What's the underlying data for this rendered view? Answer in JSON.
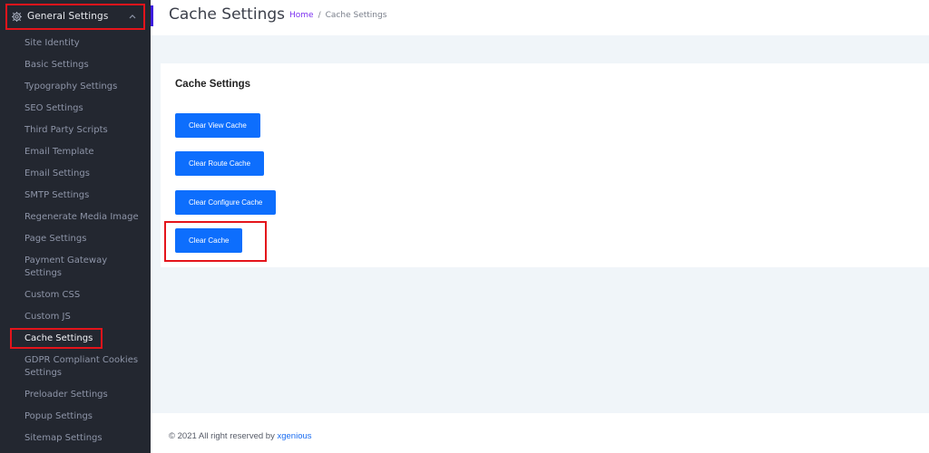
{
  "sidebar": {
    "group": {
      "label": "General Settings",
      "icon": "gear-icon",
      "expanded": true
    },
    "items": [
      {
        "label": "Site Identity",
        "active": false
      },
      {
        "label": "Basic Settings",
        "active": false
      },
      {
        "label": "Typography Settings",
        "active": false
      },
      {
        "label": "SEO Settings",
        "active": false
      },
      {
        "label": "Third Party Scripts",
        "active": false
      },
      {
        "label": "Email Template",
        "active": false
      },
      {
        "label": "Email Settings",
        "active": false
      },
      {
        "label": "SMTP Settings",
        "active": false
      },
      {
        "label": "Regenerate Media Image",
        "active": false
      },
      {
        "label": "Page Settings",
        "active": false
      },
      {
        "label": "Payment Gateway Settings",
        "active": false
      },
      {
        "label": "Custom CSS",
        "active": false
      },
      {
        "label": "Custom JS",
        "active": false
      },
      {
        "label": "Cache Settings",
        "active": true
      },
      {
        "label": "GDPR Compliant Cookies Settings",
        "active": false
      },
      {
        "label": "Preloader Settings",
        "active": false
      },
      {
        "label": "Popup Settings",
        "active": false
      },
      {
        "label": "Sitemap Settings",
        "active": false
      }
    ]
  },
  "header": {
    "title": "Cache Settings",
    "breadcrumb": {
      "home": "Home",
      "separator": "/",
      "current": "Cache Settings"
    }
  },
  "card": {
    "title": "Cache Settings",
    "buttons": [
      {
        "label": "Clear View Cache"
      },
      {
        "label": "Clear Route Cache"
      },
      {
        "label": "Clear Configure Cache"
      },
      {
        "label": "Clear Cache"
      }
    ]
  },
  "footer": {
    "text": "© 2021 All right reserved by",
    "brand": "xgenious"
  },
  "colors": {
    "sidebar_bg": "#232730",
    "accent": "#3d1de0",
    "button": "#0d6efd",
    "highlight": "#e4141b",
    "breadcrumb_home": "#7b2ff0",
    "brand_link": "#1a6cf0",
    "page_bg": "#f0f5f9"
  }
}
